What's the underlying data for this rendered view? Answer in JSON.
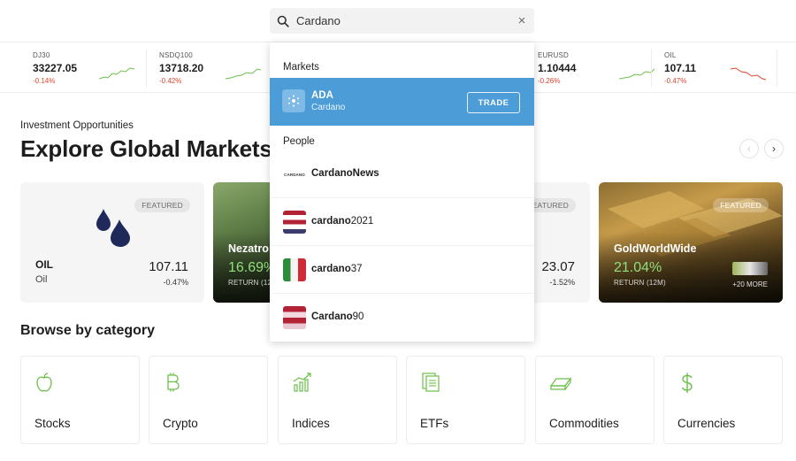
{
  "search": {
    "value": "Cardano",
    "clear": "×"
  },
  "ticker": [
    {
      "symbol": "DJ30",
      "price": "33227.05",
      "change": "-0.14%"
    },
    {
      "symbol": "NSDQ100",
      "price": "13718.20",
      "change": "-0.42%"
    },
    {
      "symbol": "EURUSD",
      "price": "1.10444",
      "change": "-0.26%"
    },
    {
      "symbol": "OIL",
      "price": "107.11",
      "change": "-0.47%"
    }
  ],
  "section": {
    "eyebrow": "Investment Opportunities",
    "title": "Explore Global Markets",
    "prev": "‹",
    "next": "›"
  },
  "cards": {
    "oil": {
      "badge": "FEATURED",
      "name": "OIL",
      "sub": "Oil",
      "price": "107.11",
      "change": "-0.47%"
    },
    "nezatro": {
      "name": "Nezatro",
      "pct": "16.69%",
      "return": "RETURN (12M)"
    },
    "hidden": {
      "badge": "FEATURED",
      "price": "23.07",
      "change": "-1.52%"
    },
    "gold": {
      "badge": "FEATURED",
      "name": "GoldWorldWide",
      "pct": "21.04%",
      "return": "RETURN (12M)",
      "more": "+20 MORE"
    }
  },
  "categories": {
    "title": "Browse by category",
    "items": [
      "Stocks",
      "Crypto",
      "Indices",
      "ETFs",
      "Commodities",
      "Currencies"
    ]
  },
  "dropdown": {
    "markets_heading": "Markets",
    "market": {
      "symbol": "ADA",
      "name": "Cardano",
      "trade": "TRADE"
    },
    "people_heading": "People",
    "people": [
      {
        "bold": "CardanoNews",
        "rest": ""
      },
      {
        "bold": "cardano",
        "rest": "2021"
      },
      {
        "bold": "cardano",
        "rest": "37"
      },
      {
        "bold": "Cardano",
        "rest": "90"
      }
    ],
    "logo_text": "CARDANO"
  },
  "colors": {
    "accent_green": "#6cbf4a",
    "negative": "#e0452e",
    "highlight": "#4c9cd7"
  }
}
